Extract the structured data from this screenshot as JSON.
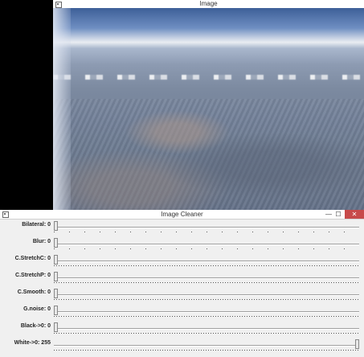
{
  "image_window": {
    "title": "Image"
  },
  "cleaner_window": {
    "title": "Image Cleaner",
    "controls": {
      "minimize": "—",
      "maximize": "☐",
      "close": "✕"
    },
    "sliders": [
      {
        "name": "Bilateral",
        "label": "Bilateral: 0",
        "value": 0,
        "ticks": "sparse"
      },
      {
        "name": "Blur",
        "label": "Blur: 0",
        "value": 0,
        "ticks": "sparse"
      },
      {
        "name": "C.StretchC",
        "label": "C.StretchC: 0",
        "value": 0,
        "ticks": "dense"
      },
      {
        "name": "C.StretchP",
        "label": "C.StretchP: 0",
        "value": 0,
        "ticks": "dense"
      },
      {
        "name": "C.Smooth",
        "label": "C.Smooth: 0",
        "value": 0,
        "ticks": "dense"
      },
      {
        "name": "G.noise",
        "label": "G.noise: 0",
        "value": 0,
        "ticks": "dense"
      },
      {
        "name": "Black->0",
        "label": "Black->0: 0",
        "value": 0,
        "ticks": "dense"
      },
      {
        "name": "White->0",
        "label": "White->0: 255",
        "value": 255,
        "max": 255,
        "ticks": "dense"
      }
    ]
  }
}
